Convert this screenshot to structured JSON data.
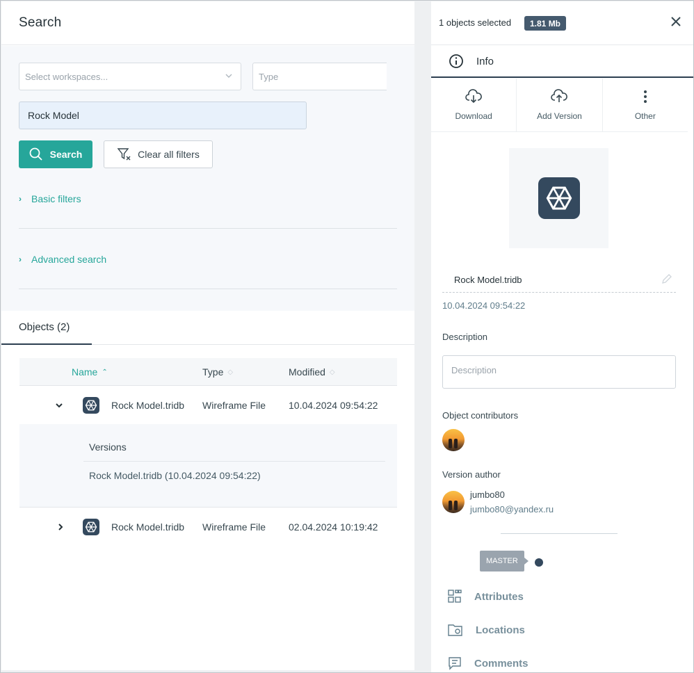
{
  "search": {
    "title": "Search",
    "workspaces_placeholder": "Select workspaces...",
    "type_placeholder": "Type",
    "query_value": "Rock Model",
    "search_button": "Search",
    "clear_button": "Clear all filters",
    "basic_filters": "Basic filters",
    "advanced_search": "Advanced search"
  },
  "objects": {
    "tab_label": "Objects (2)",
    "columns": {
      "name": "Name",
      "type": "Type",
      "modified": "Modified"
    },
    "rows": [
      {
        "name": "Rock Model.tridb",
        "type": "Wireframe File",
        "modified": "10.04.2024 09:54:22",
        "expanded": true
      },
      {
        "name": "Rock Model.tridb",
        "type": "Wireframe File",
        "modified": "02.04.2024 10:19:42",
        "expanded": false
      }
    ],
    "versions": {
      "title": "Versions",
      "items": [
        "Rock Model.tridb (10.04.2024 09:54:22)"
      ]
    }
  },
  "details": {
    "selected_text": "1 objects selected",
    "size_badge": "1.81 Mb",
    "info_tab": "Info",
    "actions": {
      "download": "Download",
      "add_version": "Add Version",
      "other": "Other"
    },
    "file_name": "Rock Model.tridb",
    "date": "10.04.2024 09:54:22",
    "description_label": "Description",
    "description_placeholder": "Description",
    "contributors_label": "Object contributors",
    "author_label": "Version author",
    "author_name": "jumbo80",
    "author_email": "jumbo80@yandex.ru",
    "branch": "MASTER",
    "sections": {
      "attributes": "Attributes",
      "locations": "Locations",
      "comments": "Comments"
    }
  },
  "colors": {
    "accent": "#26a69a",
    "dark": "#2c3e50",
    "icon_bg": "#34495e"
  }
}
